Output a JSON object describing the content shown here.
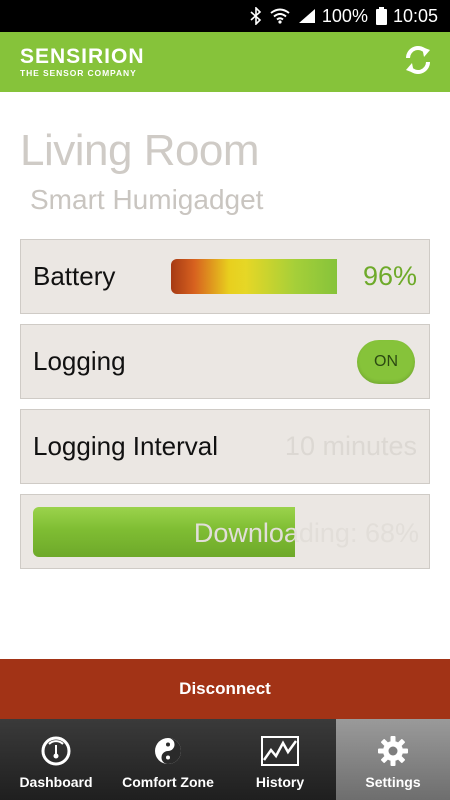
{
  "status_bar": {
    "battery_percent": "100%",
    "time": "10:05"
  },
  "header": {
    "brand_name": "SENSIRION",
    "brand_tagline": "THE SENSOR COMPANY",
    "refresh_icon": "refresh-icon",
    "accent_color": "#86c33a"
  },
  "device": {
    "name": "Living Room",
    "type": "Smart Humigadget"
  },
  "settings": {
    "battery_label": "Battery",
    "battery_value": "96%",
    "battery_level": 0.96,
    "logging_label": "Logging",
    "logging_state": "ON",
    "interval_label": "Logging Interval",
    "interval_value": "10 minutes",
    "download_text": "Downloading: 68%",
    "download_progress": 0.68
  },
  "actions": {
    "disconnect_label": "Disconnect",
    "disconnect_color": "#a23316"
  },
  "nav": {
    "items": [
      {
        "label": "Dashboard",
        "icon": "gauge-icon"
      },
      {
        "label": "Comfort Zone",
        "icon": "yin-yang-icon"
      },
      {
        "label": "History",
        "icon": "chart-icon"
      },
      {
        "label": "Settings",
        "icon": "gear-icon",
        "active": true
      }
    ]
  }
}
